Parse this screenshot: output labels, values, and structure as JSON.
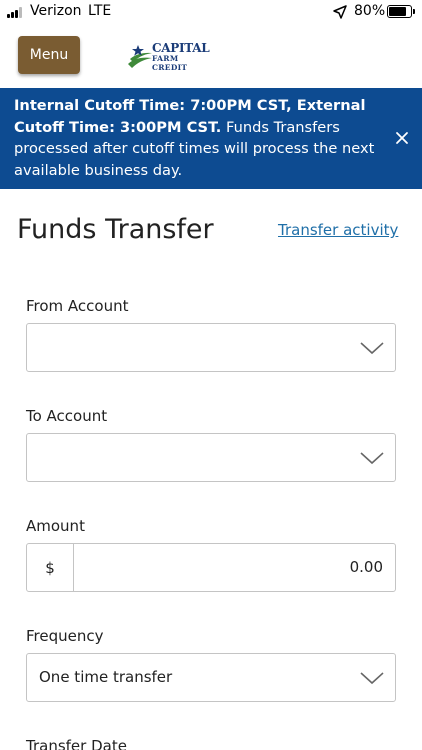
{
  "status_bar": {
    "carrier": "Verizon",
    "network": "LTE",
    "battery": "80%",
    "battery_level": 0.8
  },
  "header": {
    "menu_label": "Menu",
    "logo_line1": "CAPITAL",
    "logo_line2": "FARM CREDIT"
  },
  "banner": {
    "bold_text": "Internal Cutoff Time: 7:00PM CST, External Cutoff Time: 3:00PM CST.",
    "text": " Funds Transfers processed after cutoff times will process the next available business day."
  },
  "page": {
    "title": "Funds Transfer",
    "activity_link": "Transfer activity"
  },
  "form": {
    "from_label": "From Account",
    "from_value": "",
    "to_label": "To Account",
    "to_value": "",
    "amount_label": "Amount",
    "amount_prefix": "$",
    "amount_value": "0.00",
    "frequency_label": "Frequency",
    "frequency_value": "One time transfer",
    "date_label": "Transfer Date"
  },
  "colors": {
    "banner_bg": "#0d4b91",
    "menu_bg": "#7a5c32",
    "link": "#1f6fa8",
    "logo_blue": "#1b3c78",
    "logo_green": "#3f8a3a"
  }
}
